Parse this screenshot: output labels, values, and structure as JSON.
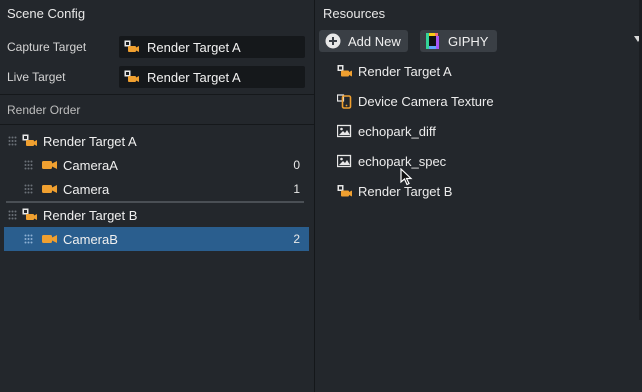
{
  "scene_config": {
    "title": "Scene Config",
    "capture_target": {
      "label": "Capture Target",
      "value": "Render Target A"
    },
    "live_target": {
      "label": "Live Target",
      "value": "Render Target A"
    }
  },
  "render_order": {
    "title": "Render Order",
    "groups": [
      {
        "label": "Render Target A",
        "cameras": [
          {
            "label": "CameraA",
            "index": "0"
          },
          {
            "label": "Camera",
            "index": "1"
          }
        ]
      },
      {
        "label": "Render Target B",
        "cameras": [
          {
            "label": "CameraB",
            "index": "2",
            "selected": true
          }
        ]
      }
    ]
  },
  "resources": {
    "title": "Resources",
    "add_label": "Add New",
    "giphy_label": "GIPHY",
    "items": [
      {
        "label": "Render Target A",
        "icon": "render-target-icon"
      },
      {
        "label": "Device Camera Texture",
        "icon": "device-camera-icon"
      },
      {
        "label": "echopark_diff",
        "icon": "image-icon"
      },
      {
        "label": "echopark_spec",
        "icon": "image-icon"
      },
      {
        "label": "Render Target B",
        "icon": "render-target-icon"
      }
    ]
  },
  "colors": {
    "background": "#23272c",
    "field_background": "#15181b",
    "selection": "#2a5e8e",
    "accent_orange": "#f0a030"
  }
}
